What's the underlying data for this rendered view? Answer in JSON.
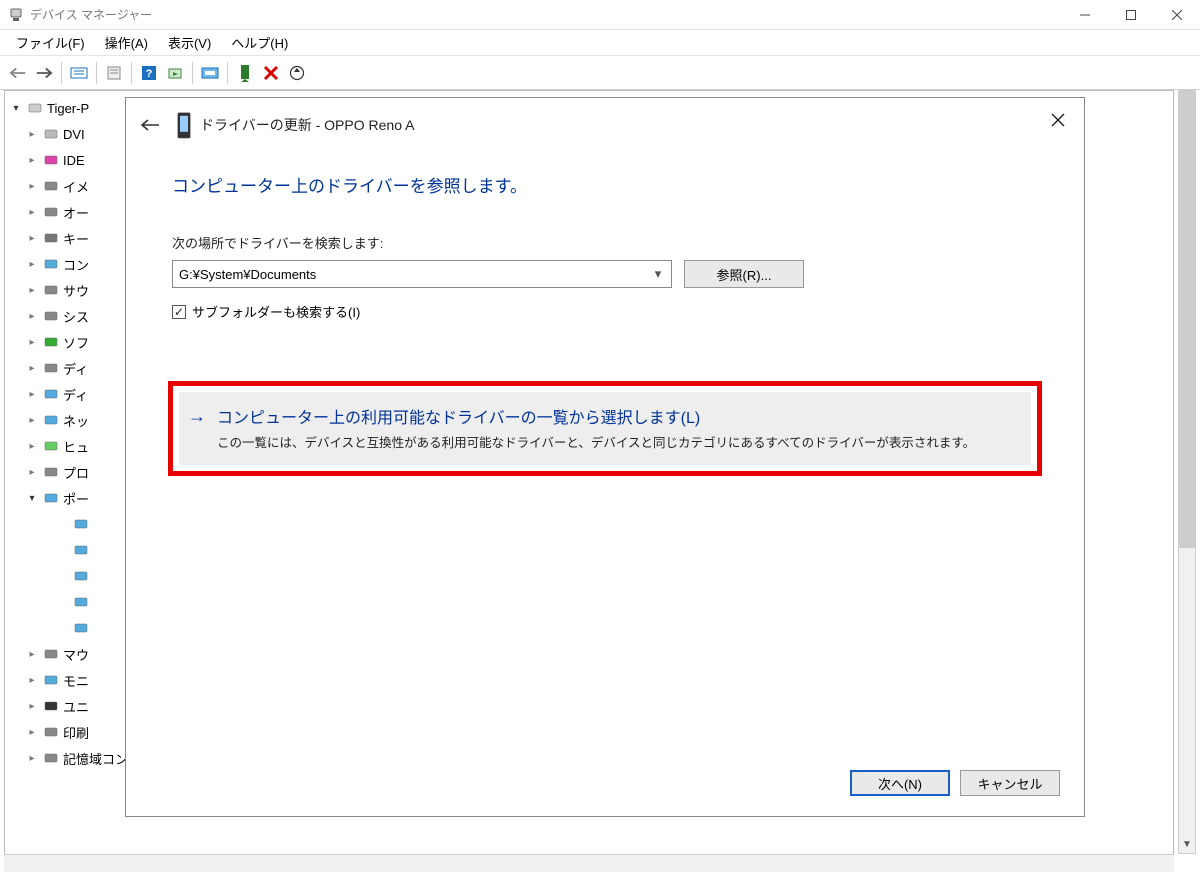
{
  "window": {
    "title": "デバイス マネージャー"
  },
  "menu": {
    "file": "ファイル(F)",
    "action": "操作(A)",
    "view": "表示(V)",
    "help": "ヘルプ(H)"
  },
  "tree": {
    "root": "Tiger-P",
    "items": [
      {
        "label": "DVI"
      },
      {
        "label": "IDE"
      },
      {
        "label": "イメ"
      },
      {
        "label": "オー"
      },
      {
        "label": "キー"
      },
      {
        "label": "コン"
      },
      {
        "label": "サウ"
      },
      {
        "label": "シス"
      },
      {
        "label": "ソフ"
      },
      {
        "label": "ディ"
      },
      {
        "label": "ディ"
      },
      {
        "label": "ネッ"
      },
      {
        "label": "ヒュ"
      },
      {
        "label": "プロ"
      }
    ],
    "ports": {
      "label": "ポー",
      "open": true,
      "children": [
        "",
        "",
        "",
        "",
        ""
      ]
    },
    "items2": [
      {
        "label": "マウ"
      },
      {
        "label": "モニ"
      },
      {
        "label": "ユニ"
      },
      {
        "label": "印刷"
      },
      {
        "label": "記憶域コントローラー"
      }
    ]
  },
  "dialog": {
    "title_prefix": "ドライバーの更新 - ",
    "device": "OPPO Reno A",
    "heading": "コンピューター上のドライバーを参照します。",
    "search_label": "次の場所でドライバーを検索します:",
    "path_value": "G:¥System¥Documents",
    "browse": "参照(R)...",
    "subfolder": "サブフォルダーも検索する(I)",
    "choice_title": "コンピューター上の利用可能なドライバーの一覧から選択します(L)",
    "choice_desc": "この一覧には、デバイスと互換性がある利用可能なドライバーと、デバイスと同じカテゴリにあるすべてのドライバーが表示されます。",
    "next": "次へ(N)",
    "cancel": "キャンセル"
  }
}
